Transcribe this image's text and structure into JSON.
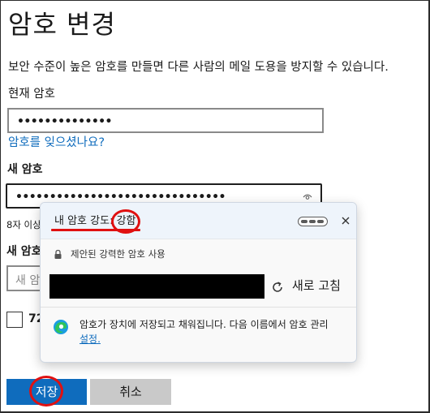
{
  "page": {
    "title": "암호 변경",
    "description": "보안 수준이 높은 암호를 만들면 다른 사람의 메일 도용을 방지할 수 있습니다."
  },
  "current_password": {
    "label": "현재 암호",
    "value": "••••••••••••••",
    "forgot_link": "암호를 잊으셨나요?"
  },
  "new_password": {
    "label": "새 암호",
    "value": "•••••••••••••••••••••••••••••••",
    "hint": "8자 이상"
  },
  "confirm_password": {
    "label": "새 암호",
    "placeholder": "새 암"
  },
  "checkbox": {
    "label": "72"
  },
  "buttons": {
    "save": "저장",
    "cancel": "취소"
  },
  "popup": {
    "strength_label": "내 암호 강도: 강함",
    "suggest_label": "제안된 강력한 암호 사용",
    "refresh_label": "새로 고침",
    "note": "암호가 장치에 저장되고 채워집니다. 다음 이름에서 암호 관리",
    "settings_link": "설정.",
    "strength_level": 1.0
  },
  "colors": {
    "accent": "#0f6cbd",
    "annotation": "#e01010",
    "cancel_bg": "#c9c9c9"
  },
  "icons": [
    "eye-icon",
    "lock-icon",
    "refresh-icon",
    "edge-icon",
    "close-icon",
    "strength-meter-icon"
  ]
}
